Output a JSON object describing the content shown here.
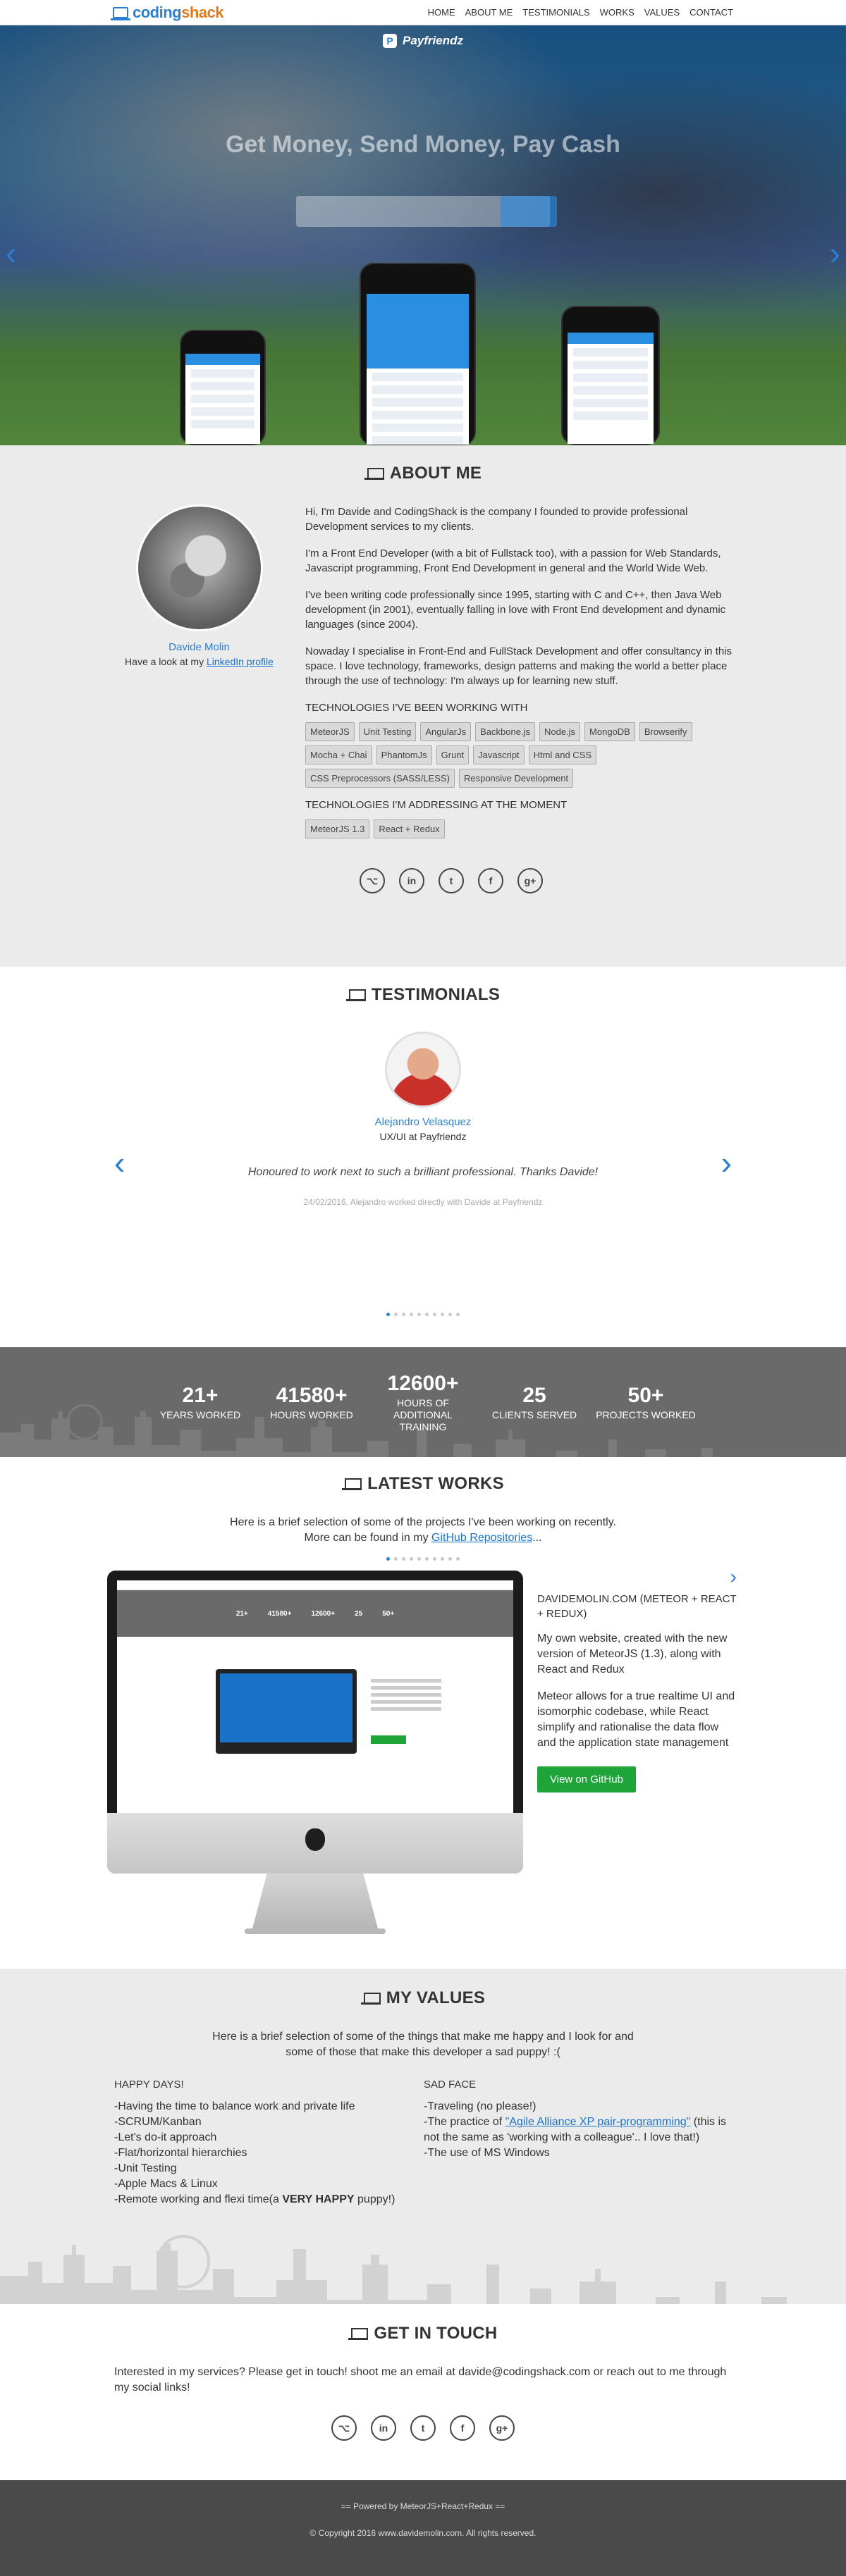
{
  "brand": {
    "part1": "coding",
    "part2": "shack"
  },
  "nav": [
    "HOME",
    "ABOUT ME",
    "TESTIMONIALS",
    "WORKS",
    "VALUES",
    "CONTACT"
  ],
  "hero": {
    "app_name": "Payfriendz",
    "headline": "Get Money, Send Money, Pay Cash",
    "prev_label": "‹",
    "next_label": "›"
  },
  "about": {
    "title": "About me",
    "name": "Davide Molin",
    "profile_prefix": "Have a look at my ",
    "profile_link": "LinkedIn profile",
    "paragraphs": [
      "Hi, I'm Davide and CodingShack is the company I founded to provide professional Development services to my clients.",
      "I'm a Front End Developer (with a bit of Fullstack too), with a passion for Web Standards, Javascript programming, Front End Development in general and the World Wide Web.",
      "I've been writing code professionally since 1995, starting with C and C++, then Java Web development (in 2001), eventually falling in love with Front End development and dynamic languages (since 2004).",
      "Nowaday I specialise in Front-End and FullStack Development and offer consultancy in this space. I love technology, frameworks, design patterns and making the world a better place through the use of technology: I'm always up for learning new stuff."
    ],
    "tech_heading": "Technologies I've been working with",
    "tech": [
      "MeteorJS",
      "Unit Testing",
      "AngularJs",
      "Backbone.js",
      "Node.js",
      "MongoDB",
      "Browserify",
      "Mocha + Chai",
      "PhantomJs",
      "Grunt",
      "Javascript",
      "Html and CSS",
      "CSS Preprocessors (SASS/LESS)",
      "Responsive Development"
    ],
    "addressing_heading": "Technologies I'm addressing at the moment",
    "addressing": [
      "MeteorJS 1.3",
      "React + Redux"
    ]
  },
  "social_icons": [
    "github-icon",
    "linkedin-icon",
    "twitter-icon",
    "facebook-icon",
    "google-plus-icon"
  ],
  "social_glyphs": [
    "⌥",
    "in",
    "t",
    "f",
    "g+"
  ],
  "testimonials": {
    "title": "Testimonials",
    "name": "Alejandro Velasquez",
    "role": "UX/UI at Payfriendz",
    "quote": "Honoured to work next to such a brilliant professional. Thanks Davide!",
    "meta": "24/02/2016, Alejandro worked directly with Davide at Payfriendz",
    "dot_count": 10,
    "active_dot": 0
  },
  "stats": [
    {
      "num": "21+",
      "label": "Years worked"
    },
    {
      "num": "41580+",
      "label": "Hours worked"
    },
    {
      "num": "12600+",
      "label": "Hours of additional training"
    },
    {
      "num": "25",
      "label": "Clients served"
    },
    {
      "num": "50+",
      "label": "Projects worked"
    }
  ],
  "works": {
    "title": "Latest works",
    "intro1": "Here is a brief selection of some of the projects I've been working on recently.",
    "intro2_prefix": "More can be found in my ",
    "intro2_link": "GitHub Repositories",
    "intro2_suffix": "...",
    "project_title": "DAVIDEMOLIN.COM (METEOR + REACT + REDUX)",
    "desc1": "My own website, created with the new version of MeteorJS (1.3), along with React and Redux",
    "desc2": "Meteor allows for a true realtime UI and isomorphic codebase, while React simplify and rationalise the data flow and the application state management",
    "button": "View on GitHub",
    "dot_count": 10,
    "active_dot": 0
  },
  "values": {
    "title": "My values",
    "intro": "Here is a brief selection of some of the things that make me happy and I look for and some of those that make this developer a sad puppy! :(",
    "happy_heading": "HAPPY DAYS!",
    "happy": [
      "-Having the time to balance work and private life",
      "-SCRUM/Kanban",
      "-Let's do-it approach",
      "-Flat/horizontal hierarchies",
      "-Unit Testing",
      "-Apple Macs & Linux"
    ],
    "happy_last_prefix": "-Remote working and flexi time(a ",
    "happy_last_strong": "VERY HAPPY",
    "happy_last_suffix": " puppy!)",
    "sad_heading": "SAD FACE",
    "sad1": "-Traveling (no please!)",
    "sad2_prefix": "-The practice of ",
    "sad2_link": "\"Agile Alliance XP pair-programming\"",
    "sad2_suffix": " (this is not the same as 'working with a colleague'.. I love that!)",
    "sad3": "-The use of MS Windows"
  },
  "contact": {
    "title": "Get in touch",
    "text": "Interested in my services? Please get in touch! shoot me an email at davide@codingshack.com or reach out to me through my social links!"
  },
  "footer": {
    "powered": "== Powered by MeteorJS+React+Redux ==",
    "copyright": "© Copyright 2016 www.davidemolin.com. All rights reserved."
  },
  "colors": {
    "accent": "#2a7fd0",
    "brand_orange": "#e07a1f",
    "button_green": "#1fa43a"
  }
}
